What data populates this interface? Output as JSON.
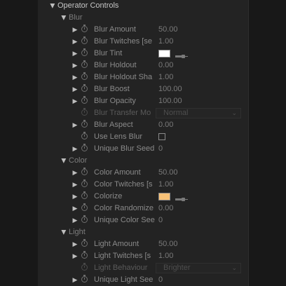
{
  "panel": {
    "title": "Operator Controls",
    "groups": [
      {
        "name": "Blur",
        "props": [
          {
            "name": "Blur Amount",
            "type": "num",
            "value": "50.00"
          },
          {
            "name": "Blur Twitches [se",
            "type": "num",
            "value": "1.00"
          },
          {
            "name": "Blur Tint",
            "type": "color",
            "value": "#ffffff"
          },
          {
            "name": "Blur Holdout",
            "type": "num",
            "value": "0.00"
          },
          {
            "name": "Blur Holdout Sha",
            "type": "num",
            "value": "1.00"
          },
          {
            "name": "Blur Boost",
            "type": "num",
            "value": "100.00"
          },
          {
            "name": "Blur Opacity",
            "type": "num",
            "value": "100.00"
          },
          {
            "name": "Blur Transfer Mo",
            "type": "dropdown",
            "value": "Normal",
            "disabled": true
          },
          {
            "name": "Blur Aspect",
            "type": "num",
            "value": "0.00"
          },
          {
            "name": "Use Lens Blur",
            "type": "check",
            "checked": false
          },
          {
            "name": "Unique Blur Seed",
            "type": "num",
            "value": "0"
          }
        ]
      },
      {
        "name": "Color",
        "props": [
          {
            "name": "Color Amount",
            "type": "num",
            "value": "50.00"
          },
          {
            "name": "Color Twitches [s",
            "type": "num",
            "value": "1.00"
          },
          {
            "name": "Colorize",
            "type": "color",
            "value": "#f7c177"
          },
          {
            "name": "Color Randomize",
            "type": "num",
            "value": "0.00"
          },
          {
            "name": "Unique Color See",
            "type": "num",
            "value": "0"
          }
        ]
      },
      {
        "name": "Light",
        "props": [
          {
            "name": "Light Amount",
            "type": "num",
            "value": "50.00"
          },
          {
            "name": "Light Twitches [s",
            "type": "num",
            "value": "1.00"
          },
          {
            "name": "Light Behaviour",
            "type": "dropdown",
            "value": "Brighter",
            "disabled": true
          },
          {
            "name": "Unique Light See",
            "type": "num",
            "value": "0"
          }
        ]
      }
    ]
  }
}
